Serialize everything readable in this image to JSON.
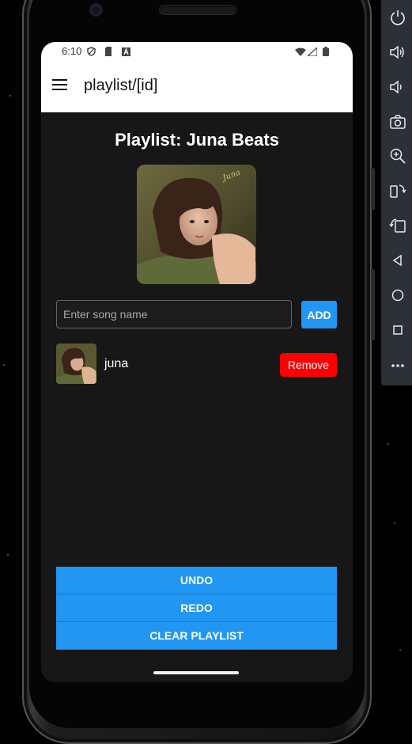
{
  "status_bar": {
    "time": "6:10"
  },
  "app_bar": {
    "title": "playlist/[id]"
  },
  "playlist": {
    "title": "Playlist: Juna Beats",
    "cover_text": "Juna"
  },
  "add_song": {
    "placeholder": "Enter song name",
    "value": "",
    "add_label": "ADD"
  },
  "songs": [
    {
      "name": "juna",
      "remove_label": "Remove"
    }
  ],
  "actions": {
    "undo_label": "UNDO",
    "redo_label": "REDO",
    "clear_label": "CLEAR PLAYLIST"
  },
  "colors": {
    "accent": "#2196f3",
    "danger": "#ff0000",
    "background": "#171717",
    "appbar": "#ffffff"
  },
  "emulator_toolbar": {
    "icons": [
      "power-icon",
      "volume-up-icon",
      "volume-down-icon",
      "camera-icon",
      "zoom-icon",
      "rotate-left-icon",
      "rotate-right-icon",
      "back-icon",
      "home-icon",
      "overview-icon",
      "more-icon"
    ]
  }
}
